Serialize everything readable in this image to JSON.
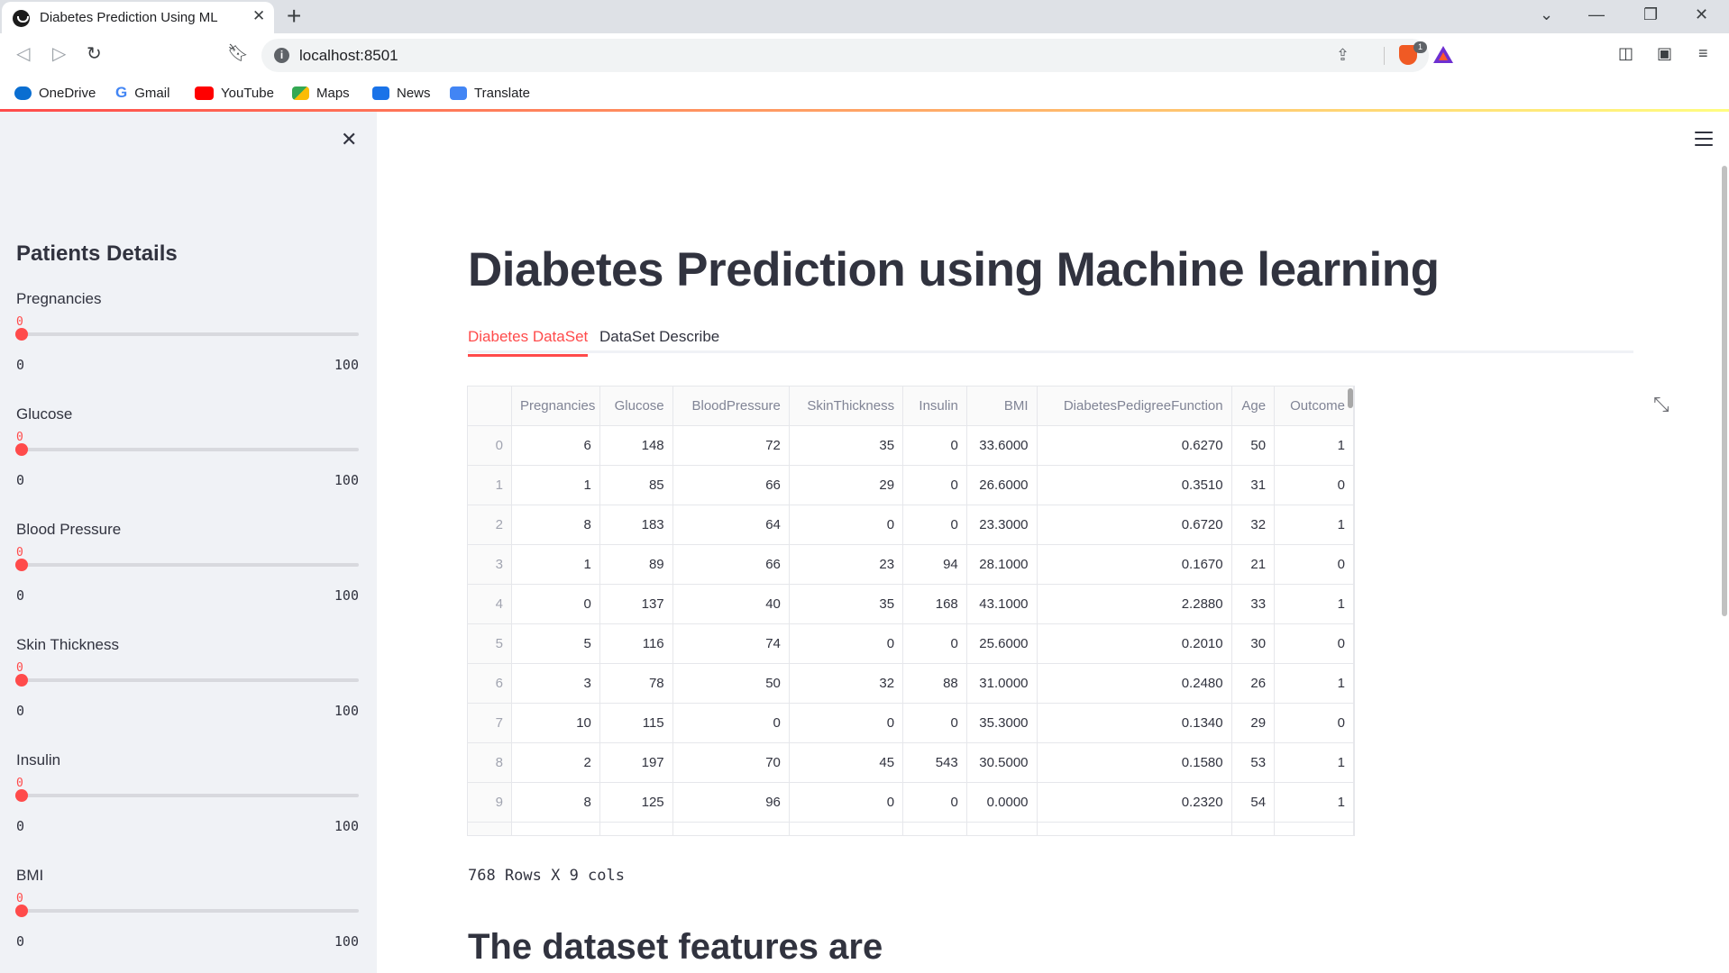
{
  "browser": {
    "tab_title": "Diabetes Prediction Using ML",
    "url": "localhost:8501",
    "brave_badge": "1",
    "bookmarks": [
      {
        "label": "OneDrive",
        "icon": "onedrive-icon"
      },
      {
        "label": "Gmail",
        "icon": "google-icon"
      },
      {
        "label": "YouTube",
        "icon": "youtube-icon"
      },
      {
        "label": "Maps",
        "icon": "maps-icon"
      },
      {
        "label": "News",
        "icon": "news-icon"
      },
      {
        "label": "Translate",
        "icon": "translate-icon"
      }
    ]
  },
  "sidebar": {
    "title": "Patients Details",
    "sliders": [
      {
        "label": "Pregnancies",
        "value": "0",
        "min": "0",
        "max": "100",
        "fraction": 0
      },
      {
        "label": "Glucose",
        "value": "0",
        "min": "0",
        "max": "100",
        "fraction": 0
      },
      {
        "label": "Blood Pressure",
        "value": "0",
        "min": "0",
        "max": "100",
        "fraction": 0
      },
      {
        "label": "Skin Thickness",
        "value": "0",
        "min": "0",
        "max": "100",
        "fraction": 0
      },
      {
        "label": "Insulin",
        "value": "0",
        "min": "0",
        "max": "100",
        "fraction": 0
      },
      {
        "label": "BMI",
        "value": "0",
        "min": "0",
        "max": "100",
        "fraction": 0
      }
    ]
  },
  "main": {
    "title": "Diabetes Prediction using Machine learning",
    "tabs": [
      {
        "label": "Diabetes DataSet",
        "active": true
      },
      {
        "label": "DataSet Describe",
        "active": false
      }
    ],
    "table": {
      "columns": [
        "",
        "Pregnancies",
        "Glucose",
        "BloodPressure",
        "SkinThickness",
        "Insulin",
        "BMI",
        "DiabetesPedigreeFunction",
        "Age",
        "Outcome"
      ],
      "rows": [
        [
          "0",
          "6",
          "148",
          "72",
          "35",
          "0",
          "33.6000",
          "0.6270",
          "50",
          "1"
        ],
        [
          "1",
          "1",
          "85",
          "66",
          "29",
          "0",
          "26.6000",
          "0.3510",
          "31",
          "0"
        ],
        [
          "2",
          "8",
          "183",
          "64",
          "0",
          "0",
          "23.3000",
          "0.6720",
          "32",
          "1"
        ],
        [
          "3",
          "1",
          "89",
          "66",
          "23",
          "94",
          "28.1000",
          "0.1670",
          "21",
          "0"
        ],
        [
          "4",
          "0",
          "137",
          "40",
          "35",
          "168",
          "43.1000",
          "2.2880",
          "33",
          "1"
        ],
        [
          "5",
          "5",
          "116",
          "74",
          "0",
          "0",
          "25.6000",
          "0.2010",
          "30",
          "0"
        ],
        [
          "6",
          "3",
          "78",
          "50",
          "32",
          "88",
          "31.0000",
          "0.2480",
          "26",
          "1"
        ],
        [
          "7",
          "10",
          "115",
          "0",
          "0",
          "0",
          "35.3000",
          "0.1340",
          "29",
          "0"
        ],
        [
          "8",
          "2",
          "197",
          "70",
          "45",
          "543",
          "30.5000",
          "0.1580",
          "53",
          "1"
        ],
        [
          "9",
          "8",
          "125",
          "96",
          "0",
          "0",
          "0.0000",
          "0.2320",
          "54",
          "1"
        ]
      ]
    },
    "caption": "768 Rows X 9 cols",
    "section_heading": "The dataset features are"
  },
  "colors": {
    "accent": "#ff4b4b",
    "sidebar_bg": "#f0f2f6",
    "text": "#31333f"
  }
}
